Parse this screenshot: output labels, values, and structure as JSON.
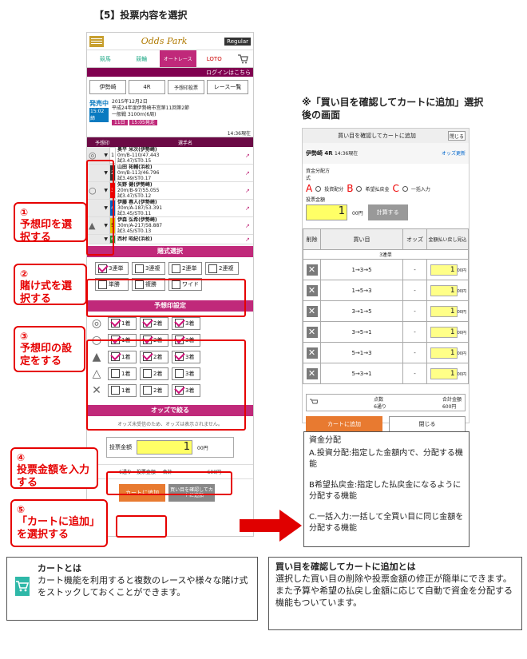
{
  "step_title": "【5】投票内容を選択",
  "header": {
    "logo": "Odds Park",
    "regular": "Regular",
    "tabs": [
      "競馬",
      "競輪",
      "オートレース",
      "LOTO"
    ],
    "login": "ログインはこちら"
  },
  "race_nav": {
    "place": "伊勢崎",
    "race": "4R",
    "yoso": "予想印投票",
    "list": "レース一覧"
  },
  "race_info": {
    "status": "発売中",
    "time": "15:02締",
    "date": "2015年12月2日",
    "name": "平成24年度伊勢崎市営第11回第2節",
    "dist": "一般戦 3100m(6周)",
    "odds_pill": "11日",
    "time_pill": "15:05発走",
    "update": "14:36現在"
  },
  "runners": {
    "col_mark": "予想印",
    "col_name": "選手名",
    "rows": [
      {
        "no": "1",
        "name": "奥平 米次(伊勢崎)",
        "l2": "0m/B-110/47.443",
        "l3": "試3.47/ST0.15"
      },
      {
        "no": "2",
        "name": "山田 祐輔(浜松)",
        "l2": "0m/B-113/46.796",
        "l3": "試3.49/ST0.17"
      },
      {
        "no": "3",
        "name": "矢野 健(伊勢崎)",
        "l2": "20m/B-97/55.055",
        "l3": "試3.47/ST0.12"
      },
      {
        "no": "4",
        "name": "伊藤 春人(伊勢崎)",
        "l2": "30m/A-187/53.391",
        "l3": "試3.45/ST0.11"
      },
      {
        "no": "5",
        "name": "伊森 弘希(伊勢崎)",
        "l2": "30m/A-217/58.887",
        "l3": "試3.45/ST0.13"
      },
      {
        "no": "6",
        "name": "西村 昭紀(浜松)",
        "l2": "",
        "l3": ""
      }
    ]
  },
  "bet_type": {
    "header": "賭式選択",
    "options": [
      "3連単",
      "3連複",
      "2連単",
      "2連複",
      "単勝",
      "複勝",
      "ワイド"
    ]
  },
  "yoso": {
    "header": "予想印設定",
    "rows": [
      {
        "mark": "◎",
        "labels": [
          "1着",
          "2着",
          "3着"
        ],
        "checked": [
          true,
          true,
          true
        ]
      },
      {
        "mark": "○",
        "labels": [
          "1着",
          "2着",
          "3着"
        ],
        "checked": [
          true,
          true,
          true
        ]
      },
      {
        "mark": "▲",
        "labels": [
          "1着",
          "2着",
          "3着"
        ],
        "checked": [
          true,
          true,
          true
        ]
      },
      {
        "mark": "△",
        "labels": [
          "1着",
          "2着",
          "3着"
        ],
        "checked": [
          false,
          false,
          false
        ]
      },
      {
        "mark": "✕",
        "labels": [
          "1着",
          "2着",
          "3着"
        ],
        "checked": [
          false,
          false,
          true
        ]
      }
    ]
  },
  "odds": {
    "header": "オッズで絞る",
    "note": "オッズ未受信のため、オッズは表示されません。"
  },
  "amount": {
    "label": "投票金額",
    "value": "1",
    "unit": "00円",
    "summary": "6通り・投票金額 = 合計",
    "total": "600円"
  },
  "buttons": {
    "cart": "カートに追加",
    "confirm": "買い目を確認してカートに追加"
  },
  "callouts": {
    "c1": {
      "num": "①",
      "text": "予想印を選択する"
    },
    "c2": {
      "num": "②",
      "text": "賭け式を選択する"
    },
    "c3": {
      "num": "③",
      "text": "予想印の設定をする"
    },
    "c4": {
      "num": "④",
      "text": "投票金額を入力する"
    },
    "c5": {
      "num": "⑤",
      "text": "「カートに追加」を選択する"
    }
  },
  "right": {
    "title": "※「買い目を確認してカートに追加」選択後の画面",
    "bar": "買い目を確認してカートに追加",
    "close": "閉じる",
    "race": "伊勢崎 4R",
    "race_time": "14:36現在",
    "odds_update": "オッズ更新",
    "dist_label": "資金分配方式",
    "opt_a": "投資配分",
    "opt_b": "希望払戻金",
    "opt_c": "一括入力",
    "amount_label": "投票金額",
    "amount": "1",
    "unit": "00円",
    "calc": "計算する",
    "cols": [
      "削除",
      "買い目",
      "オッズ",
      "金額払い戻し見込"
    ],
    "group": "3連単",
    "rows": [
      "1→3→5",
      "1→5→3",
      "3→1→5",
      "3→5→1",
      "5→1→3",
      "5→3→1"
    ],
    "odds_dash": "-",
    "row_amt": "1",
    "row_unit": "00円",
    "count_label": "点数",
    "count": "6通り",
    "sum_label": "合計金額",
    "sum": "600円",
    "cart": "カートに追加",
    "close2": "閉じる"
  },
  "explain": {
    "title": "資金分配",
    "a": "A.投資分配:指定した金額内で、分配する機能",
    "b": "B希望払戻金:指定した払戻金になるように分配する機能",
    "c": "C.一括入力:一括して全買い目に同じ金額を分配する機能"
  },
  "cart_box": {
    "title": "カートとは",
    "text": "カート機能を利用すると複数のレースや様々な賭け式をストックしておくことができます。"
  },
  "confirm_box": {
    "title": "買い目を確認してカートに追加とは",
    "text1": "選択した買い目の削除や投票金額の修正が簡単にできます。",
    "text2": "また予算や希望の払戻し金額に応じて自動で資金を分配する機能もついています。"
  }
}
